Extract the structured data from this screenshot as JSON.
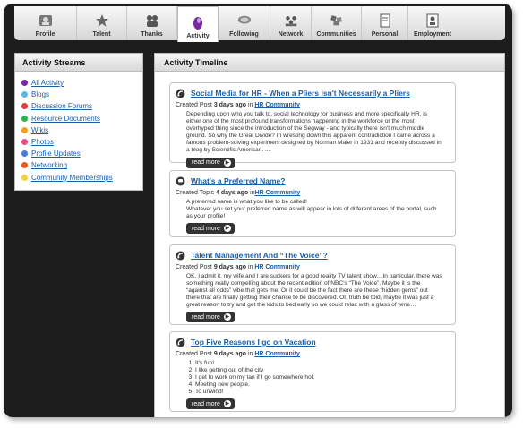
{
  "nav": [
    {
      "label": "Profile",
      "icon": "profile-icon"
    },
    {
      "label": "Talent",
      "icon": "star-icon"
    },
    {
      "label": "Thanks",
      "icon": "thanks-icon"
    },
    {
      "label": "Activity",
      "icon": "activity-icon",
      "active": true
    },
    {
      "label": "Following",
      "icon": "following-icon"
    },
    {
      "label": "Network",
      "icon": "network-icon"
    },
    {
      "label": "Communities",
      "icon": "communities-icon"
    },
    {
      "label": "Personal",
      "icon": "personal-icon"
    },
    {
      "label": "Employment",
      "icon": "employment-icon"
    }
  ],
  "streams": {
    "title": "Activity Streams",
    "items": [
      {
        "label": "All Activity",
        "color": "#7a2aa0"
      },
      {
        "label": "Blogs",
        "color": "#5bb7e8"
      },
      {
        "label": "Discussion Forums",
        "color": "#e23b3b"
      },
      {
        "label": "Resource Documents",
        "color": "#2bb24c"
      },
      {
        "label": "Wikis",
        "color": "#f0a020"
      },
      {
        "label": "Photos",
        "color": "#e84a8a"
      },
      {
        "label": "Profile Updates",
        "color": "#4a7ad8"
      },
      {
        "label": "Networking",
        "color": "#e8571f"
      },
      {
        "label": "Community Memberships",
        "color": "#f2d23a"
      }
    ]
  },
  "timeline": {
    "title": "Activity Timeline",
    "read_more": "read more",
    "posts": [
      {
        "title": "Social Media for HR - When a Pliers Isn't Necessarily a Pliers",
        "meta_prefix": "Created Post",
        "time": "3 days ago",
        "in_text": "in",
        "community": "HR Community",
        "body": "Depending upon who you talk to, social technology for business and more specifically HR, is either one of the most profound transformations happening in the workforce or the most overhyped thing since the introduction of the Segway - and typically there isn't much middle ground.  So why the Great Divide?  In wresting down this apparent contradiction I came across a famous problem-solving experiment designed by Norman Maier in 1931 and recently discussed in a blog by Scientific American. ..."
      },
      {
        "title": "What's a Preferred Name?",
        "meta_prefix": "Created Topic",
        "time": "4 days ago",
        "in_text": "in",
        "community": "HR Community",
        "body": "A preferred name is what you like to be called!\nWhatever you set your preferred name as will appear in lots of different areas of the portal, such as your profile!"
      },
      {
        "title": "Talent Management And “The Voice”?",
        "meta_prefix": "Created Post",
        "time": "9 days ago",
        "in_text": "in",
        "community": "HR Community",
        "body": "OK, I admit it, my wife and I are suckers for a good reality TV talent show…In particular, there was something really compelling about the recent edition of NBC's “The Voice”.  Maybe it is the “against all odds” vibe that gets me.  Or it could be the fact there are these “hidden gems” out there that are finally getting their chance to be discovered.  Or, truth be told, maybe it was just a great reason to try and get the kids to bed early so we could relax with a glass of wine…"
      },
      {
        "title": "Top Five Reasons I go on Vacation",
        "meta_prefix": "Created Post",
        "time": "9 days ago",
        "in_text": "in",
        "community": "HR Community",
        "list": [
          "It's fun!",
          "I like getting out of the city",
          "I get to work on my tan if I go somewhere hot.",
          "Meeting new people.",
          "To unwind!"
        ]
      }
    ]
  }
}
